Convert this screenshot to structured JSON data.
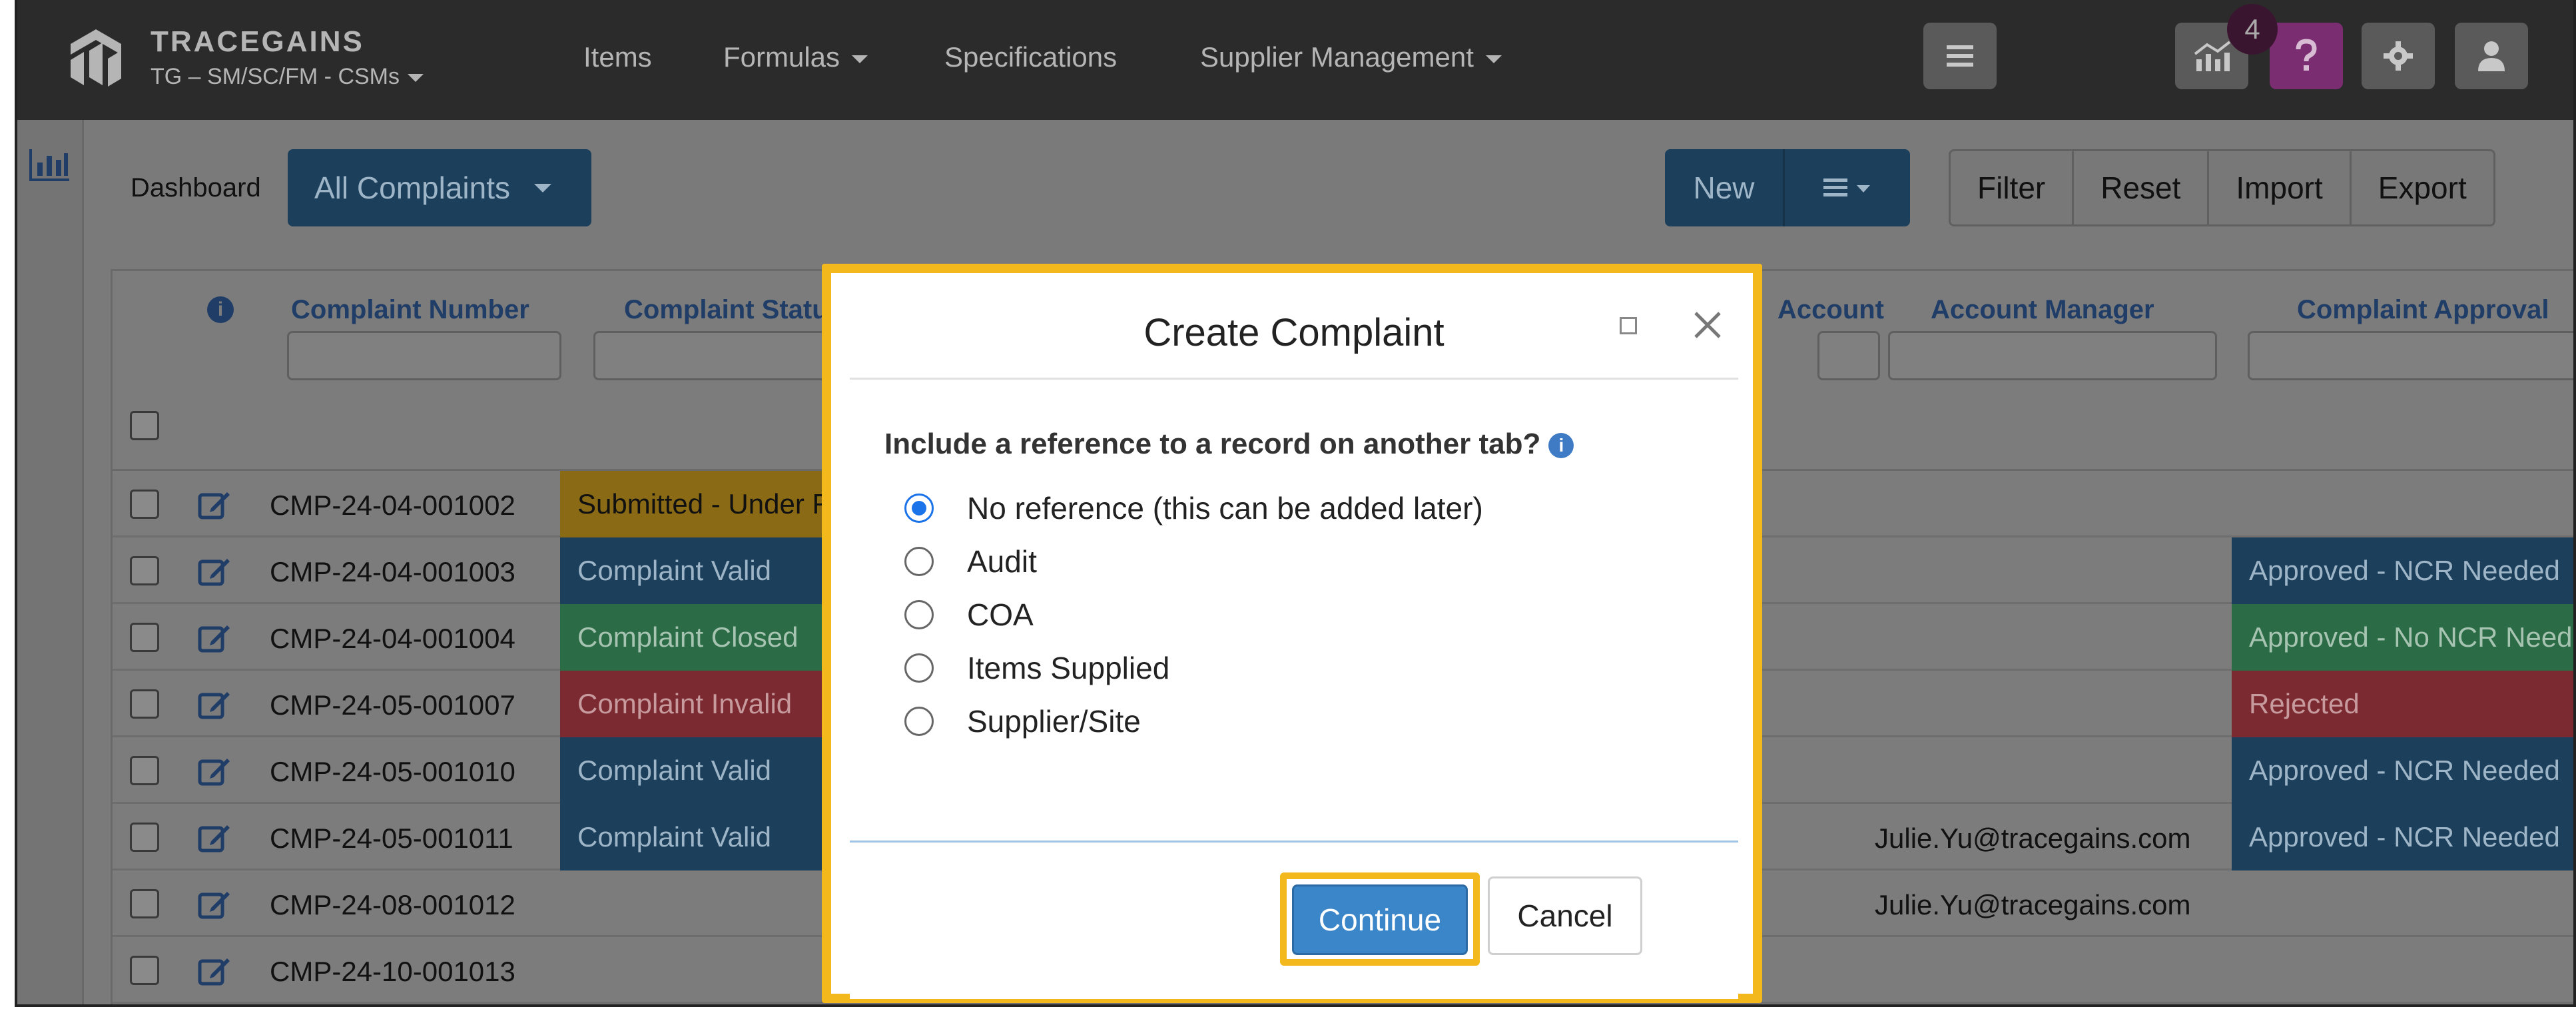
{
  "brand": {
    "name": "TRACEGAINS",
    "subtitle": "TG – SM/SC/FM - CSMs"
  },
  "nav": {
    "items": [
      "Items",
      "Formulas",
      "Specifications",
      "Supplier Management"
    ],
    "notification_count": "4",
    "icons": [
      "hamburger-icon",
      "analytics-icon",
      "help-icon",
      "gear-icon",
      "user-icon"
    ]
  },
  "toolbar": {
    "dashboard_label": "Dashboard",
    "view_select": "All Complaints",
    "new_label": "New",
    "filter_label": "Filter",
    "reset_label": "Reset",
    "import_label": "Import",
    "export_label": "Export"
  },
  "table": {
    "columns": {
      "number": "Complaint Number",
      "status": "Complaint Status",
      "account": "Account",
      "manager": "Account Manager",
      "approval": "Complaint Approval"
    },
    "rows": [
      {
        "number": "CMP-24-04-001002",
        "status": "Submitted - Under Review",
        "manager": "",
        "approval": ""
      },
      {
        "number": "CMP-24-04-001003",
        "status": "Complaint Valid",
        "manager": "",
        "approval": "Approved - NCR Needed"
      },
      {
        "number": "CMP-24-04-001004",
        "status": "Complaint Closed",
        "manager": "",
        "approval": "Approved - No NCR Needed"
      },
      {
        "number": "CMP-24-05-001007",
        "status": "Complaint Invalid",
        "manager": "",
        "approval": "Rejected"
      },
      {
        "number": "CMP-24-05-001010",
        "status": "Complaint Valid",
        "manager": "",
        "approval": "Approved - NCR Needed"
      },
      {
        "number": "CMP-24-05-001011",
        "status": "Complaint Valid",
        "manager": "Julie.Yu@tracegains.com",
        "approval": "Approved - NCR Needed"
      },
      {
        "number": "CMP-24-08-001012",
        "status": "",
        "manager": "Julie.Yu@tracegains.com",
        "approval": ""
      },
      {
        "number": "CMP-24-10-001013",
        "status": "",
        "manager": "",
        "approval": ""
      }
    ]
  },
  "modal": {
    "title": "Create Complaint",
    "question": "Include a reference to a record on another tab?",
    "options": [
      "No reference (this can be added later)",
      "Audit",
      "COA",
      "Items Supplied",
      "Supplier/Site"
    ],
    "selected": "No reference (this can be added later)",
    "continue_label": "Continue",
    "cancel_label": "Cancel"
  },
  "colors": {
    "highlight": "#f3b81b",
    "primary": "#3b86c8",
    "status_valid": "#1c3f5c",
    "status_closed": "#2b6b45",
    "status_invalid": "#7a2a30",
    "status_submitted": "#8a6a14"
  }
}
